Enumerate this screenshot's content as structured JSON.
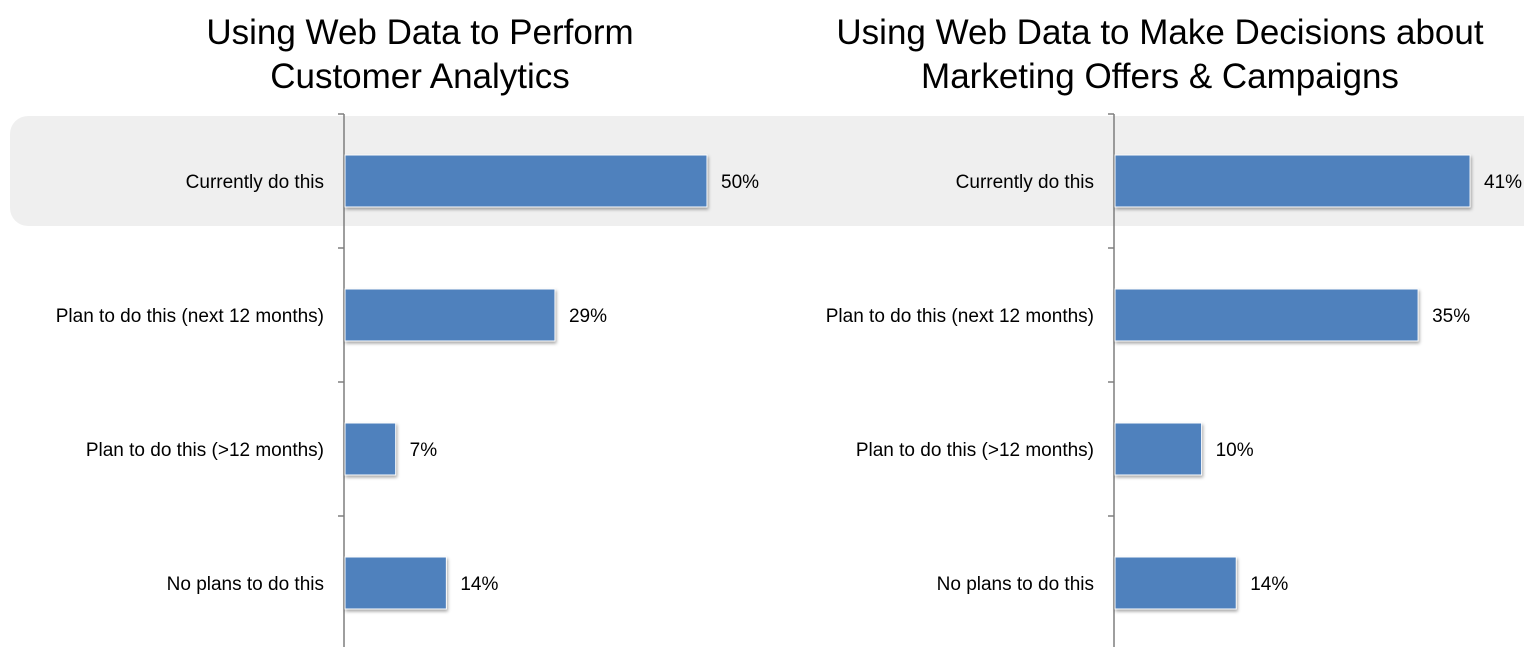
{
  "chart_data": [
    {
      "type": "bar",
      "orientation": "horizontal",
      "title": "Using Web Data to Perform Customer Analytics",
      "categories": [
        "Currently do this",
        "Plan to do this (next 12 months)",
        "Plan to do this (>12 months)",
        "No plans to do this"
      ],
      "values": [
        50,
        29,
        7,
        14
      ],
      "value_labels": [
        "50%",
        "29%",
        "7%",
        "14%"
      ],
      "highlighted_category": "Currently do this",
      "bar_color": "#4f81bd",
      "grid": false,
      "legend": "none"
    },
    {
      "type": "bar",
      "orientation": "horizontal",
      "title": "Using Web Data to Make Decisions about Marketing Offers & Campaigns",
      "categories": [
        "Currently do this",
        "Plan to do this (next 12 months)",
        "Plan to do this (>12 months)",
        "No plans to do this"
      ],
      "values": [
        41,
        35,
        10,
        14
      ],
      "value_labels": [
        "41%",
        "35%",
        "10%",
        "14%"
      ],
      "highlighted_category": "Currently do this",
      "bar_color": "#4f81bd",
      "grid": false,
      "legend": "none"
    }
  ],
  "colors": {
    "bar": "#4f81bd",
    "bar_border": "#ffffff",
    "axis": "#7f7f7f",
    "highlight_band": "#efefef"
  }
}
